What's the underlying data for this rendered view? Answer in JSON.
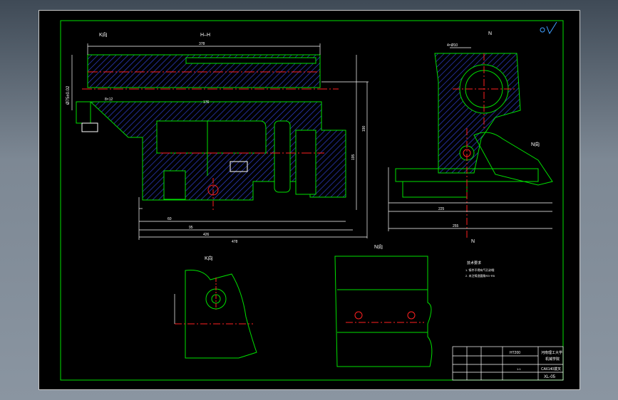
{
  "colors": {
    "background": "#000000",
    "outline": "#00e000",
    "dimension": "#ffffff",
    "center_line": "#ff2020",
    "hatch": "#3040d0",
    "frame": "#ffffff"
  },
  "views": {
    "main_section": "H–H",
    "main_view_k": "K向",
    "side_section": "N",
    "side_view_n": "N向",
    "side_marker_lower": "N",
    "detail_k_title": "K向",
    "detail_n_title": "N向"
  },
  "dimensions": {
    "top_width": "378",
    "bore_dia": "Ø75±0.02",
    "slot_label": "8×12",
    "depth_label": "176",
    "height_a": "195",
    "height_b": "190",
    "bottom_a": "60",
    "bottom_b": "95",
    "bottom_c": "426",
    "bottom_d": "478",
    "side_top": "4×Ø10",
    "side_bottom_a": "225",
    "side_bottom_b": "255"
  },
  "notes": {
    "title": "技术要求",
    "line1": "1. 铸件不得有气孔砂眼",
    "line2": "2. 未注铸造圆角R3~R5"
  },
  "title_block": {
    "school": "河南理工大学",
    "dept": "机械学院",
    "part": "CA6140拨叉",
    "material": "HT200",
    "drawing_no": "XL-05",
    "scale": "1:1"
  }
}
